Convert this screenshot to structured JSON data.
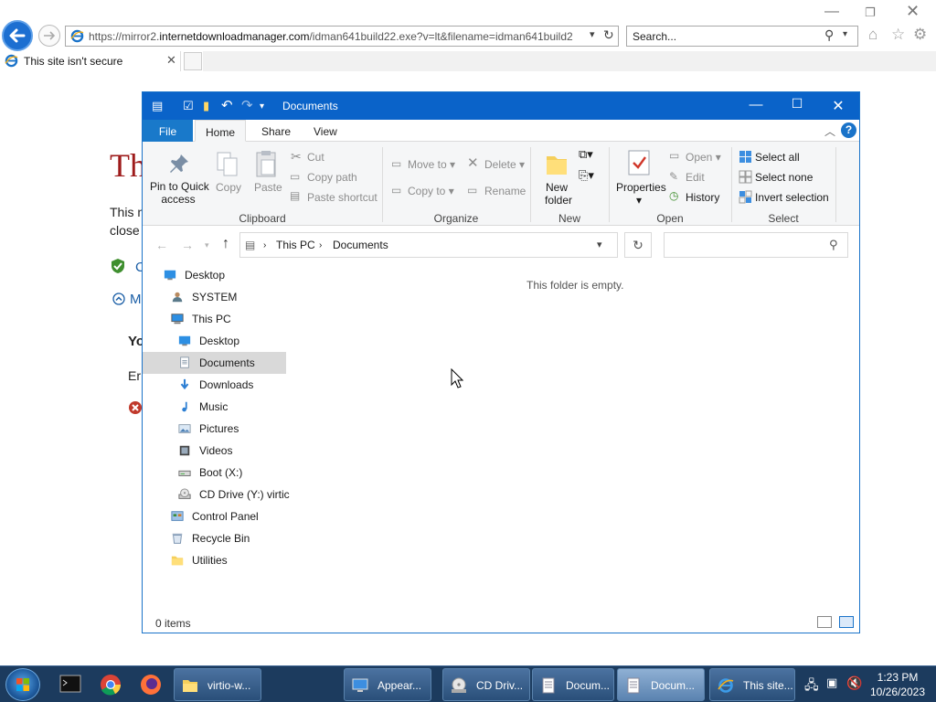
{
  "browser": {
    "url_prefix": "https://mirror2.",
    "url_domain": "internetdownloadmanager.com",
    "url_rest": "/idman641build22.exe?v=lt&filename=idman641build2",
    "search_placeholder": "Search...",
    "tab_title": "This site isn't secure",
    "page": {
      "heading": "Th",
      "line1": "This n",
      "line2": "close",
      "link1": "C",
      "link2": "M",
      "bold": "Yo",
      "line3": "Er"
    }
  },
  "explorer": {
    "title": "Documents",
    "tabs": [
      "File",
      "Home",
      "Share",
      "View"
    ],
    "active_tab": "Home",
    "ribbon": {
      "clipboard": {
        "label": "Clipboard",
        "pin": "Pin to Quick access",
        "pin_l1": "Pin to Quick",
        "pin_l2": "access",
        "copy": "Copy",
        "paste": "Paste",
        "cut": "Cut",
        "copy_path": "Copy path",
        "paste_shortcut": "Paste shortcut"
      },
      "organize": {
        "label": "Organize",
        "move_to": "Move to",
        "copy_to": "Copy to",
        "delete": "Delete",
        "rename": "Rename"
      },
      "new": {
        "label": "New",
        "new_folder_l1": "New",
        "new_folder_l2": "folder"
      },
      "open": {
        "label": "Open",
        "properties": "Properties",
        "open": "Open",
        "edit": "Edit",
        "history": "History"
      },
      "select": {
        "label": "Select",
        "select_all": "Select all",
        "select_none": "Select none",
        "invert": "Invert selection"
      }
    },
    "breadcrumb": [
      "This PC",
      "Documents"
    ],
    "tree": [
      {
        "label": "Desktop",
        "icon": "desktop-icon",
        "indent": 0
      },
      {
        "label": "SYSTEM",
        "icon": "user-icon",
        "indent": 1
      },
      {
        "label": "This PC",
        "icon": "pc-icon",
        "indent": 1
      },
      {
        "label": "Desktop",
        "icon": "desktop-icon",
        "indent": 2
      },
      {
        "label": "Documents",
        "icon": "documents-icon",
        "indent": 2,
        "selected": true
      },
      {
        "label": "Downloads",
        "icon": "downloads-icon",
        "indent": 2
      },
      {
        "label": "Music",
        "icon": "music-icon",
        "indent": 2
      },
      {
        "label": "Pictures",
        "icon": "pictures-icon",
        "indent": 2
      },
      {
        "label": "Videos",
        "icon": "videos-icon",
        "indent": 2
      },
      {
        "label": "Boot (X:)",
        "icon": "drive-icon",
        "indent": 2
      },
      {
        "label": "CD Drive (Y:) virtic",
        "icon": "cd-drive-icon",
        "indent": 2
      },
      {
        "label": "Control Panel",
        "icon": "control-panel-icon",
        "indent": 1
      },
      {
        "label": "Recycle Bin",
        "icon": "recycle-bin-icon",
        "indent": 1
      },
      {
        "label": "Utilities",
        "icon": "folder-icon",
        "indent": 1
      }
    ],
    "empty_message": "This folder is empty.",
    "status": "0 items"
  },
  "taskbar": {
    "buttons": [
      {
        "label": "virtio-w...",
        "icon": "folder-icon"
      },
      {
        "label": "Appear...",
        "icon": "display-icon"
      },
      {
        "label": "CD Driv...",
        "icon": "cd-drive-icon"
      },
      {
        "label": "Docum...",
        "icon": "documents-icon"
      },
      {
        "label": "Docum...",
        "icon": "documents-icon",
        "active": true
      },
      {
        "label": "This site...",
        "icon": "ie-icon"
      }
    ],
    "time": "1:23 PM",
    "date": "10/26/2023"
  },
  "colors": {
    "explorer_title": "#0a63c9",
    "file_tab": "#1979ca",
    "taskbar": "#1c3b5e",
    "warning_red": "#9e1b1b"
  }
}
